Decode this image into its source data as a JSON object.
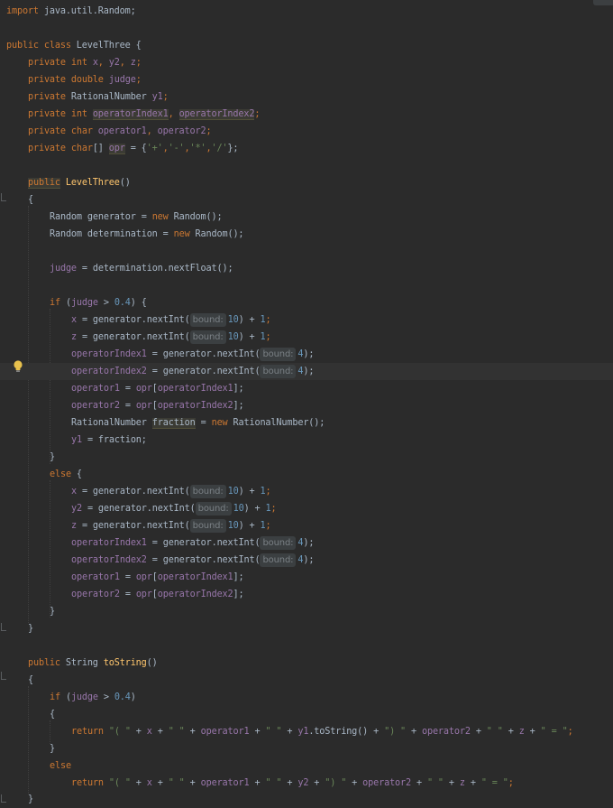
{
  "code": {
    "l1_import": "import",
    "l1_rest": " java.util.Random;",
    "l3_public": "public",
    "l3_class": " class ",
    "l3_name": "LevelThree {",
    "l4_kw": "private int ",
    "l4_x": "x",
    "l4_sep1": ", ",
    "l4_y2": "y2",
    "l4_sep2": ", ",
    "l4_z": "z",
    "l4_end": ";",
    "l5_kw": "private double ",
    "l5_judge": "judge",
    "l5_end": ";",
    "l6_kw": "private ",
    "l6_type": "RationalNumber ",
    "l6_y1": "y1",
    "l6_end": ";",
    "l7_kw": "private int ",
    "l7_idx1": "operatorIndex1",
    "l7_sep": ", ",
    "l7_idx2": "operatorIndex2",
    "l7_end": ";",
    "l8_kw": "private char ",
    "l8_op1": "operator1",
    "l8_sep": ", ",
    "l8_op2": "operator2",
    "l8_end": ";",
    "l9_kw": "private char",
    "l9_arr": "[] ",
    "l9_opr": "opr",
    "l9_eq": " = {",
    "l9_c1": "'+'",
    "l9_s1": ",",
    "l9_c2": "'-'",
    "l9_s2": ",",
    "l9_c3": "'*'",
    "l9_s3": ",",
    "l9_c4": "'/'",
    "l9_end": "};",
    "l11_public": "public",
    "l11_sp": " ",
    "l11_ctor": "LevelThree",
    "l11_end": "()",
    "l12": "{",
    "l13_a": "Random generator = ",
    "l13_new": "new",
    "l13_b": " Random();",
    "l14_a": "Random determination = ",
    "l14_new": "new",
    "l14_b": " Random();",
    "l16_judge": "judge",
    "l16_rest": " = determination.nextFloat();",
    "l18_if": "if",
    "l18_a": " (",
    "l18_judge": "judge",
    "l18_b": " > ",
    "l18_num": "0.4",
    "l18_c": ") {",
    "l19_x": "x",
    "l19_a": " = generator.nextInt(",
    "l19_num": "10",
    "l19_b": ") + ",
    "l19_one": "1",
    "l19_end": ";",
    "l20_z": "z",
    "l20_a": " = generator.nextInt(",
    "l20_num": "10",
    "l20_b": ") + ",
    "l20_one": "1",
    "l20_end": ";",
    "l21_f": "operatorIndex1",
    "l21_a": " = generator.nextInt(",
    "l21_num": "4",
    "l21_end": ");",
    "l22_f": "operatorIndex2",
    "l22_a": " = generator.nextInt(",
    "l22_num": "4",
    "l22_end": ");",
    "l23_f": "operator1",
    "l23_a": " = ",
    "l23_opr": "opr",
    "l23_b": "[",
    "l23_idx": "operatorIndex1",
    "l23_end": "];",
    "l24_f": "operator2",
    "l24_a": " = ",
    "l24_opr": "opr",
    "l24_b": "[",
    "l24_idx": "operatorIndex2",
    "l24_end": "];",
    "l25_a": "RationalNumber ",
    "l25_frac": "fraction",
    "l25_b": " = ",
    "l25_new": "new",
    "l25_c": " RationalNumber();",
    "l26_y1": "y1",
    "l26_rest": " = fraction;",
    "l27": "}",
    "l28_else": "else",
    "l28_rest": " {",
    "l29_x": "x",
    "l29_a": " = generator.nextInt(",
    "l29_num": "10",
    "l29_b": ") + ",
    "l29_one": "1",
    "l29_end": ";",
    "l30_y2": "y2",
    "l30_a": " = generator.nextInt(",
    "l30_num": "10",
    "l30_b": ") + ",
    "l30_one": "1",
    "l30_end": ";",
    "l31_z": "z",
    "l31_a": " = generator.nextInt(",
    "l31_num": "10",
    "l31_b": ") + ",
    "l31_one": "1",
    "l31_end": ";",
    "l32_f": "operatorIndex1",
    "l32_a": " = generator.nextInt(",
    "l32_num": "4",
    "l32_end": ");",
    "l33_f": "operatorIndex2",
    "l33_a": " = generator.nextInt(",
    "l33_num": "4",
    "l33_end": ");",
    "l34_f": "operator1",
    "l34_a": " = ",
    "l34_opr": "opr",
    "l34_b": "[",
    "l34_idx": "operatorIndex1",
    "l34_end": "];",
    "l35_f": "operator2",
    "l35_a": " = ",
    "l35_opr": "opr",
    "l35_b": "[",
    "l35_idx": "operatorIndex2",
    "l35_end": "];",
    "l36": "}",
    "l37": "}",
    "l39_public": "public",
    "l39_a": " String ",
    "l39_fn": "toString",
    "l39_end": "()",
    "l40": "{",
    "l41_if": "if",
    "l41_a": " (",
    "l41_judge": "judge",
    "l41_b": " > ",
    "l41_num": "0.4",
    "l41_end": ")",
    "l42": "{",
    "l43_ret": "return",
    "l43_sp": " ",
    "l43_s1": "\"( \"",
    "l43_a": " + ",
    "l43_x": "x",
    "l43_b": " + ",
    "l43_s2": "\" \"",
    "l43_c": " + ",
    "l43_op1": "operator1",
    "l43_d": " + ",
    "l43_s3": "\" \"",
    "l43_e": " + ",
    "l43_y1": "y1",
    "l43_f": ".toString() + ",
    "l43_s4": "\") \"",
    "l43_g": " + ",
    "l43_op2": "operator2",
    "l43_h": " + ",
    "l43_s5": "\" \"",
    "l43_i": " + ",
    "l43_z": "z",
    "l43_j": " + ",
    "l43_s6": "\" = \"",
    "l43_end": ";",
    "l44": "}",
    "l45_else": "else",
    "l46_ret": "return",
    "l46_sp": " ",
    "l46_s1": "\"( \"",
    "l46_a": " + ",
    "l46_x": "x",
    "l46_b": " + ",
    "l46_s2": "\" \"",
    "l46_c": " + ",
    "l46_op1": "operator1",
    "l46_d": " + ",
    "l46_s3": "\" \"",
    "l46_e": " + ",
    "l46_y2": "y2",
    "l46_f": " + ",
    "l46_s4": "\") \"",
    "l46_g": " + ",
    "l46_op2": "operator2",
    "l46_h": " + ",
    "l46_s5": "\" \"",
    "l46_i": " + ",
    "l46_z": "z",
    "l46_j": " + ",
    "l46_s6": "\" = \"",
    "l46_end": ";",
    "l47": "}"
  },
  "hints": {
    "bound": "bound:"
  },
  "colors": {
    "background": "#2b2b2b",
    "keyword": "#cc7832",
    "field": "#9876aa",
    "string": "#6a8759",
    "number": "#6897bb",
    "method": "#ffc66d",
    "text": "#a9b7c6"
  },
  "icons": {
    "gutter": "intention-bulb-icon",
    "folding": "fold-marker-icon"
  }
}
